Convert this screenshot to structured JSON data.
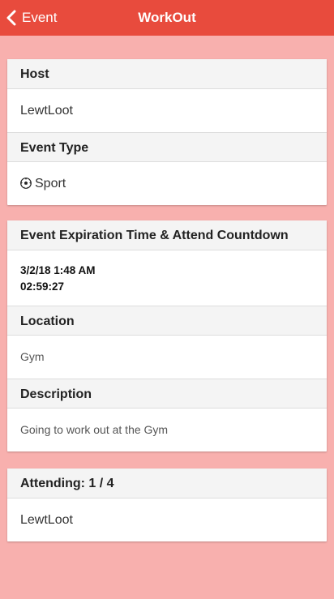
{
  "nav": {
    "back_label": "Event",
    "title": "WorkOut"
  },
  "event_card": {
    "host_header": "Host",
    "host_value": "LewtLoot",
    "type_header": "Event Type",
    "type_value": "Sport",
    "type_icon": "soccer-ball-icon"
  },
  "details_card": {
    "expiration_header": "Event Expiration Time & Attend Countdown",
    "expiration_time": "3/2/18 1:48 AM",
    "countdown": "02:59:27",
    "location_header": "Location",
    "location_value": "Gym",
    "description_header": "Description",
    "description_value": "Going to work out at the Gym"
  },
  "attending_card": {
    "header": "Attending: 1 / 4",
    "attendees": [
      "LewtLoot"
    ]
  },
  "colors": {
    "navbar": "#e84b3d",
    "background": "#f8b0ae",
    "card_header": "#f4f4f4"
  }
}
